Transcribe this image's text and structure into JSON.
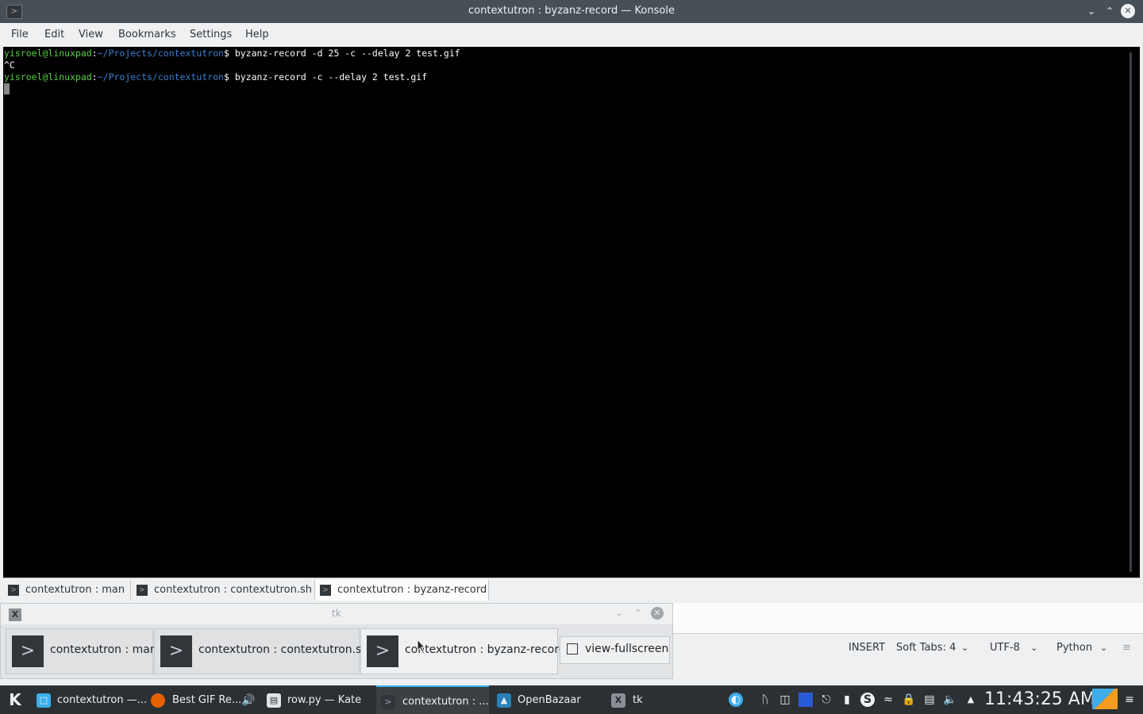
{
  "window": {
    "title": "contextutron : byzanz-record — Konsole",
    "icon": "terminal-icon"
  },
  "menubar": [
    "File",
    "Edit",
    "View",
    "Bookmarks",
    "Settings",
    "Help"
  ],
  "terminal": {
    "lines": [
      {
        "user": "yisroel@linuxpad",
        "sep": ":",
        "path": "~/Projects/contextutron",
        "prompt": "$ ",
        "cmd": "byzanz-record -d 25 -c --delay 2 test.gif"
      },
      {
        "text": "^C"
      },
      {
        "user": "yisroel@linuxpad",
        "sep": ":",
        "path": "~/Projects/contextutron",
        "prompt": "$ ",
        "cmd": "byzanz-record -c --delay 2 test.gif"
      }
    ]
  },
  "konsole_tabs": [
    {
      "label": "contextutron : man"
    },
    {
      "label": "contextutron : contextutron.sh"
    },
    {
      "label": "contextutron : byzanz-record",
      "active": true
    }
  ],
  "tk_window": {
    "title": "tk",
    "buttons": [
      {
        "label": "contextutron : man"
      },
      {
        "label": "contextutron : contextutron.sh"
      },
      {
        "label": "contextutron : byzanz-record"
      }
    ],
    "fullscreen_label": "view-fullscreen"
  },
  "kate_status": {
    "mode": "INSERT",
    "tabs": "Soft Tabs: 4",
    "encoding": "UTF-8",
    "language": "Python"
  },
  "taskbar": {
    "tasks": [
      {
        "label": "contextutron —...",
        "icon": "dolphin-icon"
      },
      {
        "label": "Best GIF Re...",
        "icon": "firefox-icon"
      },
      {
        "label": "row.py  — Kate",
        "icon": "kate-icon"
      },
      {
        "label": "contextutron : ...",
        "icon": "konsole-icon",
        "active": true
      },
      {
        "label": "OpenBazaar",
        "icon": "openbazaar-icon"
      },
      {
        "label": "tk",
        "icon": "tk-icon"
      }
    ],
    "clock": "11:43:25 AM"
  }
}
